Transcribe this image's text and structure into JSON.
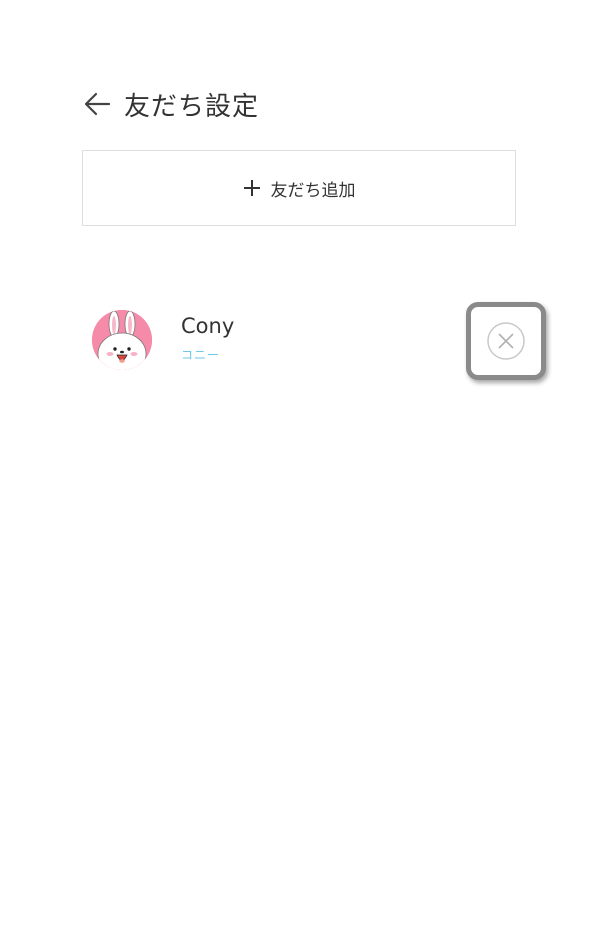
{
  "header": {
    "title": "友だち設定",
    "back_icon": "arrow-left-icon"
  },
  "add_friend": {
    "label": "友だち追加",
    "icon": "plus-icon"
  },
  "friends": [
    {
      "name": "Cony",
      "reading": "コニー",
      "avatar": "cony-bunny-avatar",
      "action_icon": "circle-x-icon"
    }
  ],
  "colors": {
    "text": "#333333",
    "reading": "#6fc6e8",
    "avatar_bg": "#f58aa9",
    "border": "#dedede"
  }
}
